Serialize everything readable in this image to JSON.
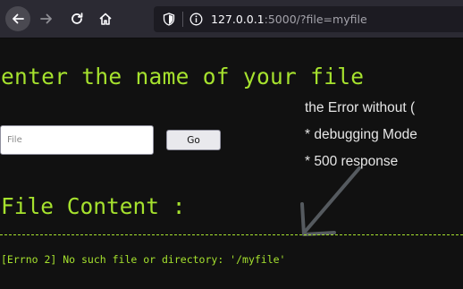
{
  "browser": {
    "url_host": "127.0.0.1",
    "url_rest": ":5000/?file=myfile"
  },
  "page": {
    "heading": "enter the name of your file",
    "input_placeholder": "File",
    "go_label": "Go",
    "notes": [
      "the Error without (",
      "* debugging Mode",
      "* 500 response"
    ],
    "content_title": "File Content :",
    "error_message": "[Errno 2] No such file or directory: '/myfile'"
  },
  "colors": {
    "accent_green": "#a6e22e",
    "background": "#111111",
    "toolbar": "#2b2a33"
  },
  "icons": [
    "back-arrow-icon",
    "forward-arrow-icon",
    "reload-icon",
    "home-icon",
    "shield-icon",
    "info-icon",
    "annotation-arrow-icon"
  ]
}
